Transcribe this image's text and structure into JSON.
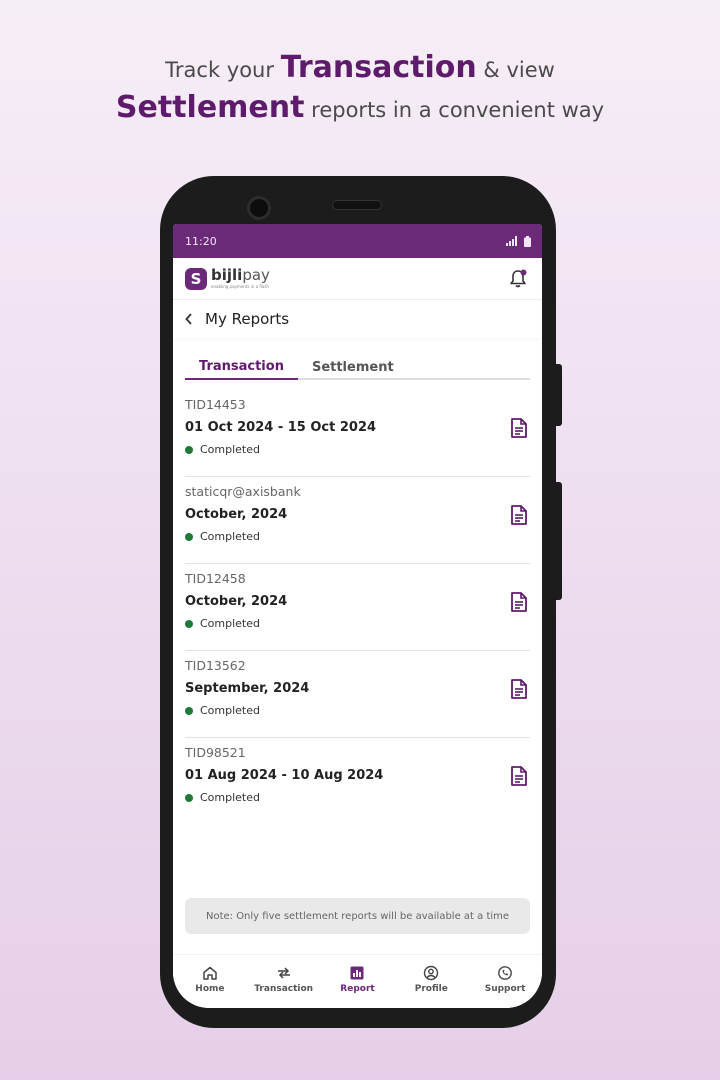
{
  "headline": {
    "line1_pre": "Track your ",
    "line1_bold": "Transaction",
    "line1_post": " & view",
    "line2_bold": "Settlement",
    "line2_post": " reports in a convenient way"
  },
  "statusbar": {
    "time": "11:20"
  },
  "app": {
    "logo_name_bold": "bijli",
    "logo_name_rest": "pay",
    "logo_tagline": "enabling payments in a flash"
  },
  "page": {
    "title": "My Reports"
  },
  "tabs": [
    {
      "label": "Transaction",
      "active": true
    },
    {
      "label": "Settlement",
      "active": false
    }
  ],
  "reports": [
    {
      "id": "TID14453",
      "period": "01 Oct 2024 - 15 Oct 2024",
      "status": "Completed"
    },
    {
      "id": "staticqr@axisbank",
      "period": "October, 2024",
      "status": "Completed"
    },
    {
      "id": "TID12458",
      "period": "October, 2024",
      "status": "Completed"
    },
    {
      "id": "TID13562",
      "period": "September, 2024",
      "status": "Completed"
    },
    {
      "id": "TID98521",
      "period": "01 Aug 2024 - 10 Aug 2024",
      "status": "Completed"
    }
  ],
  "note": "Note: Only five settlement reports will be available at a time",
  "bottom_nav": [
    {
      "label": "Home",
      "icon": "home-icon",
      "active": false
    },
    {
      "label": "Transaction",
      "icon": "transfer-icon",
      "active": false
    },
    {
      "label": "Report",
      "icon": "report-icon",
      "active": true
    },
    {
      "label": "Profile",
      "icon": "profile-icon",
      "active": false
    },
    {
      "label": "Support",
      "icon": "support-icon",
      "active": false
    }
  ],
  "colors": {
    "brand": "#6b2a78",
    "headline_accent": "#5e1b6b",
    "status_completed": "#1f7a3a"
  }
}
